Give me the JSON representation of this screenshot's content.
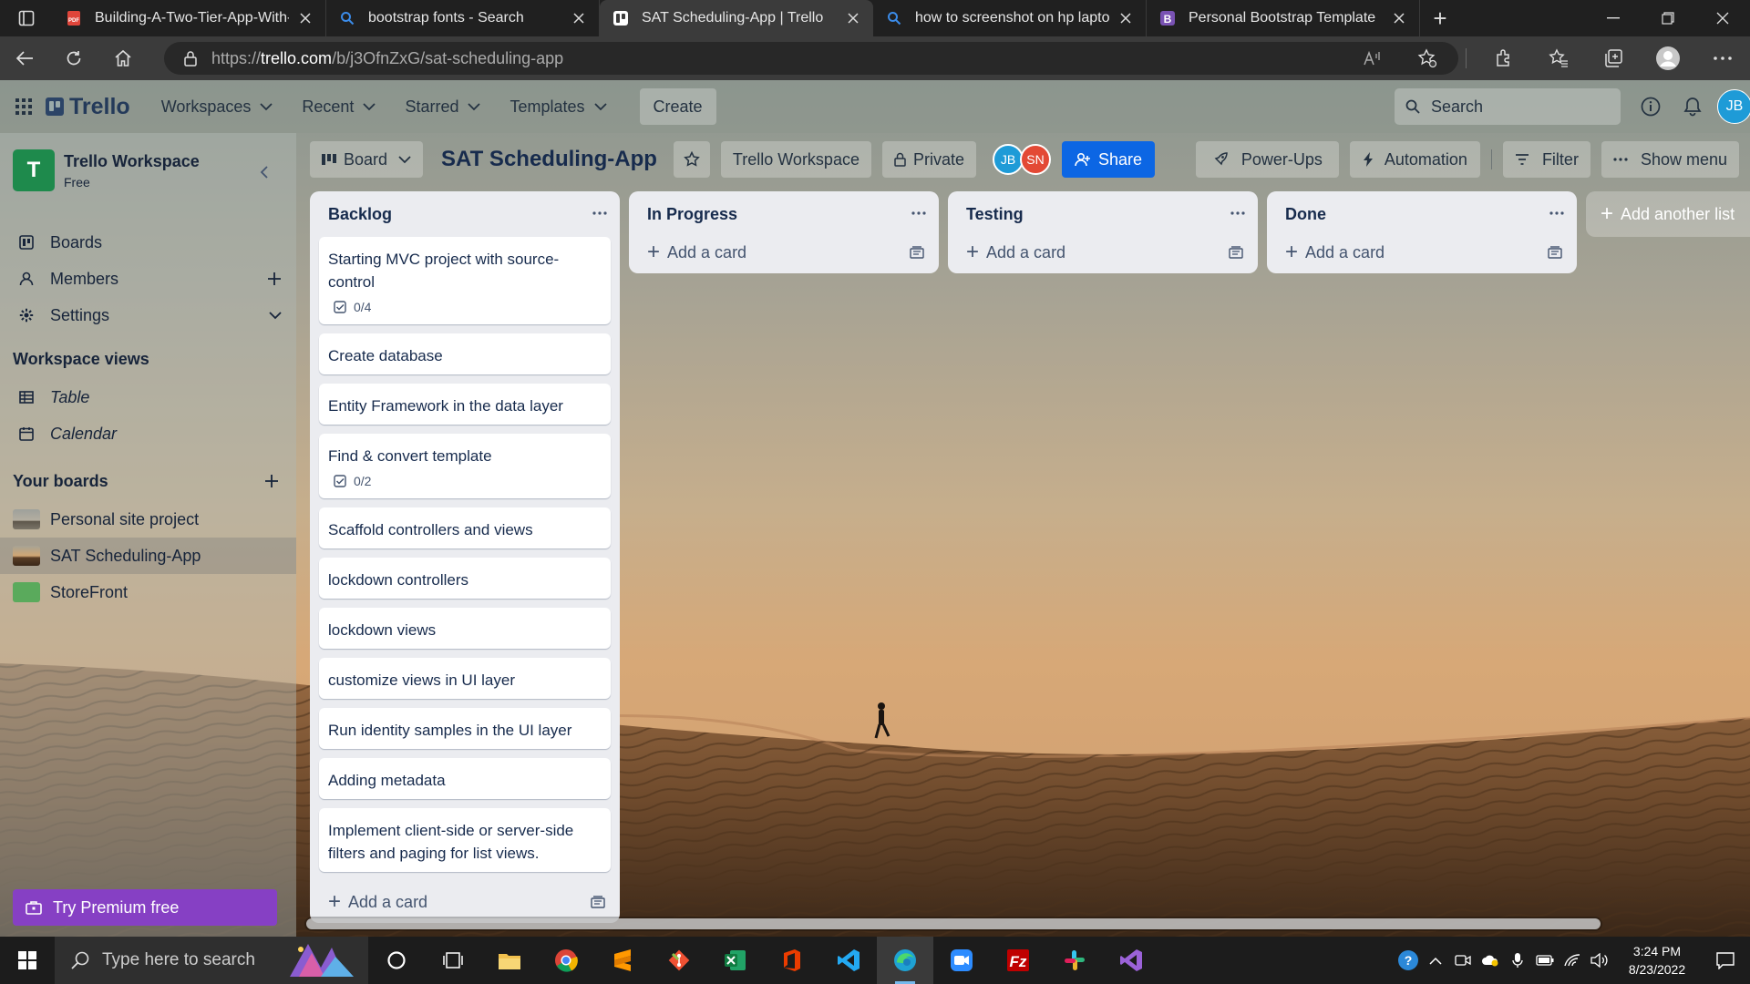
{
  "browser": {
    "tabs": [
      {
        "title": "Building-A-Two-Tier-App-With-I",
        "favicon": "pdf-icon",
        "color": "#e0453a"
      },
      {
        "title": "bootstrap fonts - Search",
        "favicon": "bing-search-icon",
        "color": "#3b8be8"
      },
      {
        "title": "SAT Scheduling-App | Trello",
        "favicon": "trello-icon",
        "color": "#ffffff",
        "active": true
      },
      {
        "title": "how to screenshot on hp laptop",
        "favicon": "bing-search-icon",
        "color": "#3b8be8"
      },
      {
        "title": "Personal Bootstrap Template",
        "favicon": "bootstrap-icon",
        "color": "#7952b3"
      }
    ],
    "url_prefix": "https://",
    "url_domain": "trello.com",
    "url_path": "/b/j3OfnZxG/sat-scheduling-app"
  },
  "trello": {
    "logo": "Trello",
    "nav": {
      "workspaces": "Workspaces",
      "recent": "Recent",
      "starred": "Starred",
      "templates": "Templates",
      "create": "Create",
      "search_placeholder": "Search",
      "avatar_initials": "JB"
    },
    "sidebar": {
      "workspace_initial": "T",
      "workspace_name": "Trello Workspace",
      "plan": "Free",
      "items": [
        {
          "label": "Boards",
          "icon": "boards-icon"
        },
        {
          "label": "Members",
          "icon": "members-icon"
        },
        {
          "label": "Settings",
          "icon": "settings-icon"
        }
      ],
      "views_heading": "Workspace views",
      "views": [
        {
          "label": "Table",
          "icon": "table-icon"
        },
        {
          "label": "Calendar",
          "icon": "calendar-icon"
        }
      ],
      "boards_heading": "Your boards",
      "boards": [
        {
          "label": "Personal site project",
          "thumb": "#7d7f78"
        },
        {
          "label": "SAT Scheduling-App",
          "thumb": "#6a5a48",
          "current": true
        },
        {
          "label": "StoreFront",
          "thumb": "#5aaa5c"
        }
      ],
      "premium": "Try Premium free"
    },
    "board_bar": {
      "view": "Board",
      "title": "SAT Scheduling-App",
      "workspace": "Trello Workspace",
      "visibility": "Private",
      "members": [
        {
          "initials": "JB",
          "color": "#1e9bd7"
        },
        {
          "initials": "SN",
          "color": "#e34935"
        }
      ],
      "share": "Share",
      "powerups": "Power-Ups",
      "automation": "Automation",
      "filter": "Filter",
      "show_menu": "Show menu"
    },
    "lists": [
      {
        "title": "Backlog",
        "cards": [
          {
            "title": "Starting MVC project with source-control",
            "checklist": "0/4"
          },
          {
            "title": "Create database"
          },
          {
            "title": "Entity Framework in the data layer"
          },
          {
            "title": "Find & convert template",
            "checklist": "0/2"
          },
          {
            "title": "Scaffold controllers and views"
          },
          {
            "title": "lockdown controllers"
          },
          {
            "title": "lockdown views"
          },
          {
            "title": "customize views in UI layer"
          },
          {
            "title": "Run identity samples in the UI layer"
          },
          {
            "title": "Adding metadata"
          },
          {
            "title": "Implement client-side or server-side filters and paging for list views."
          }
        ]
      },
      {
        "title": "In Progress",
        "cards": []
      },
      {
        "title": "Testing",
        "cards": []
      },
      {
        "title": "Done",
        "cards": []
      }
    ],
    "add_card": "Add a card",
    "add_list": "Add another list"
  },
  "taskbar": {
    "search_placeholder": "Type here to search",
    "time": "3:24 PM",
    "date": "8/23/2022",
    "apps": [
      "cortana-icon",
      "task-view-icon",
      "file-explorer-icon",
      "chrome-icon",
      "sublime-icon",
      "git-icon",
      "excel-icon",
      "office-icon",
      "vscode-icon",
      "edge-icon",
      "zoom-icon",
      "filezilla-icon",
      "slack-icon",
      "visual-studio-icon"
    ]
  }
}
